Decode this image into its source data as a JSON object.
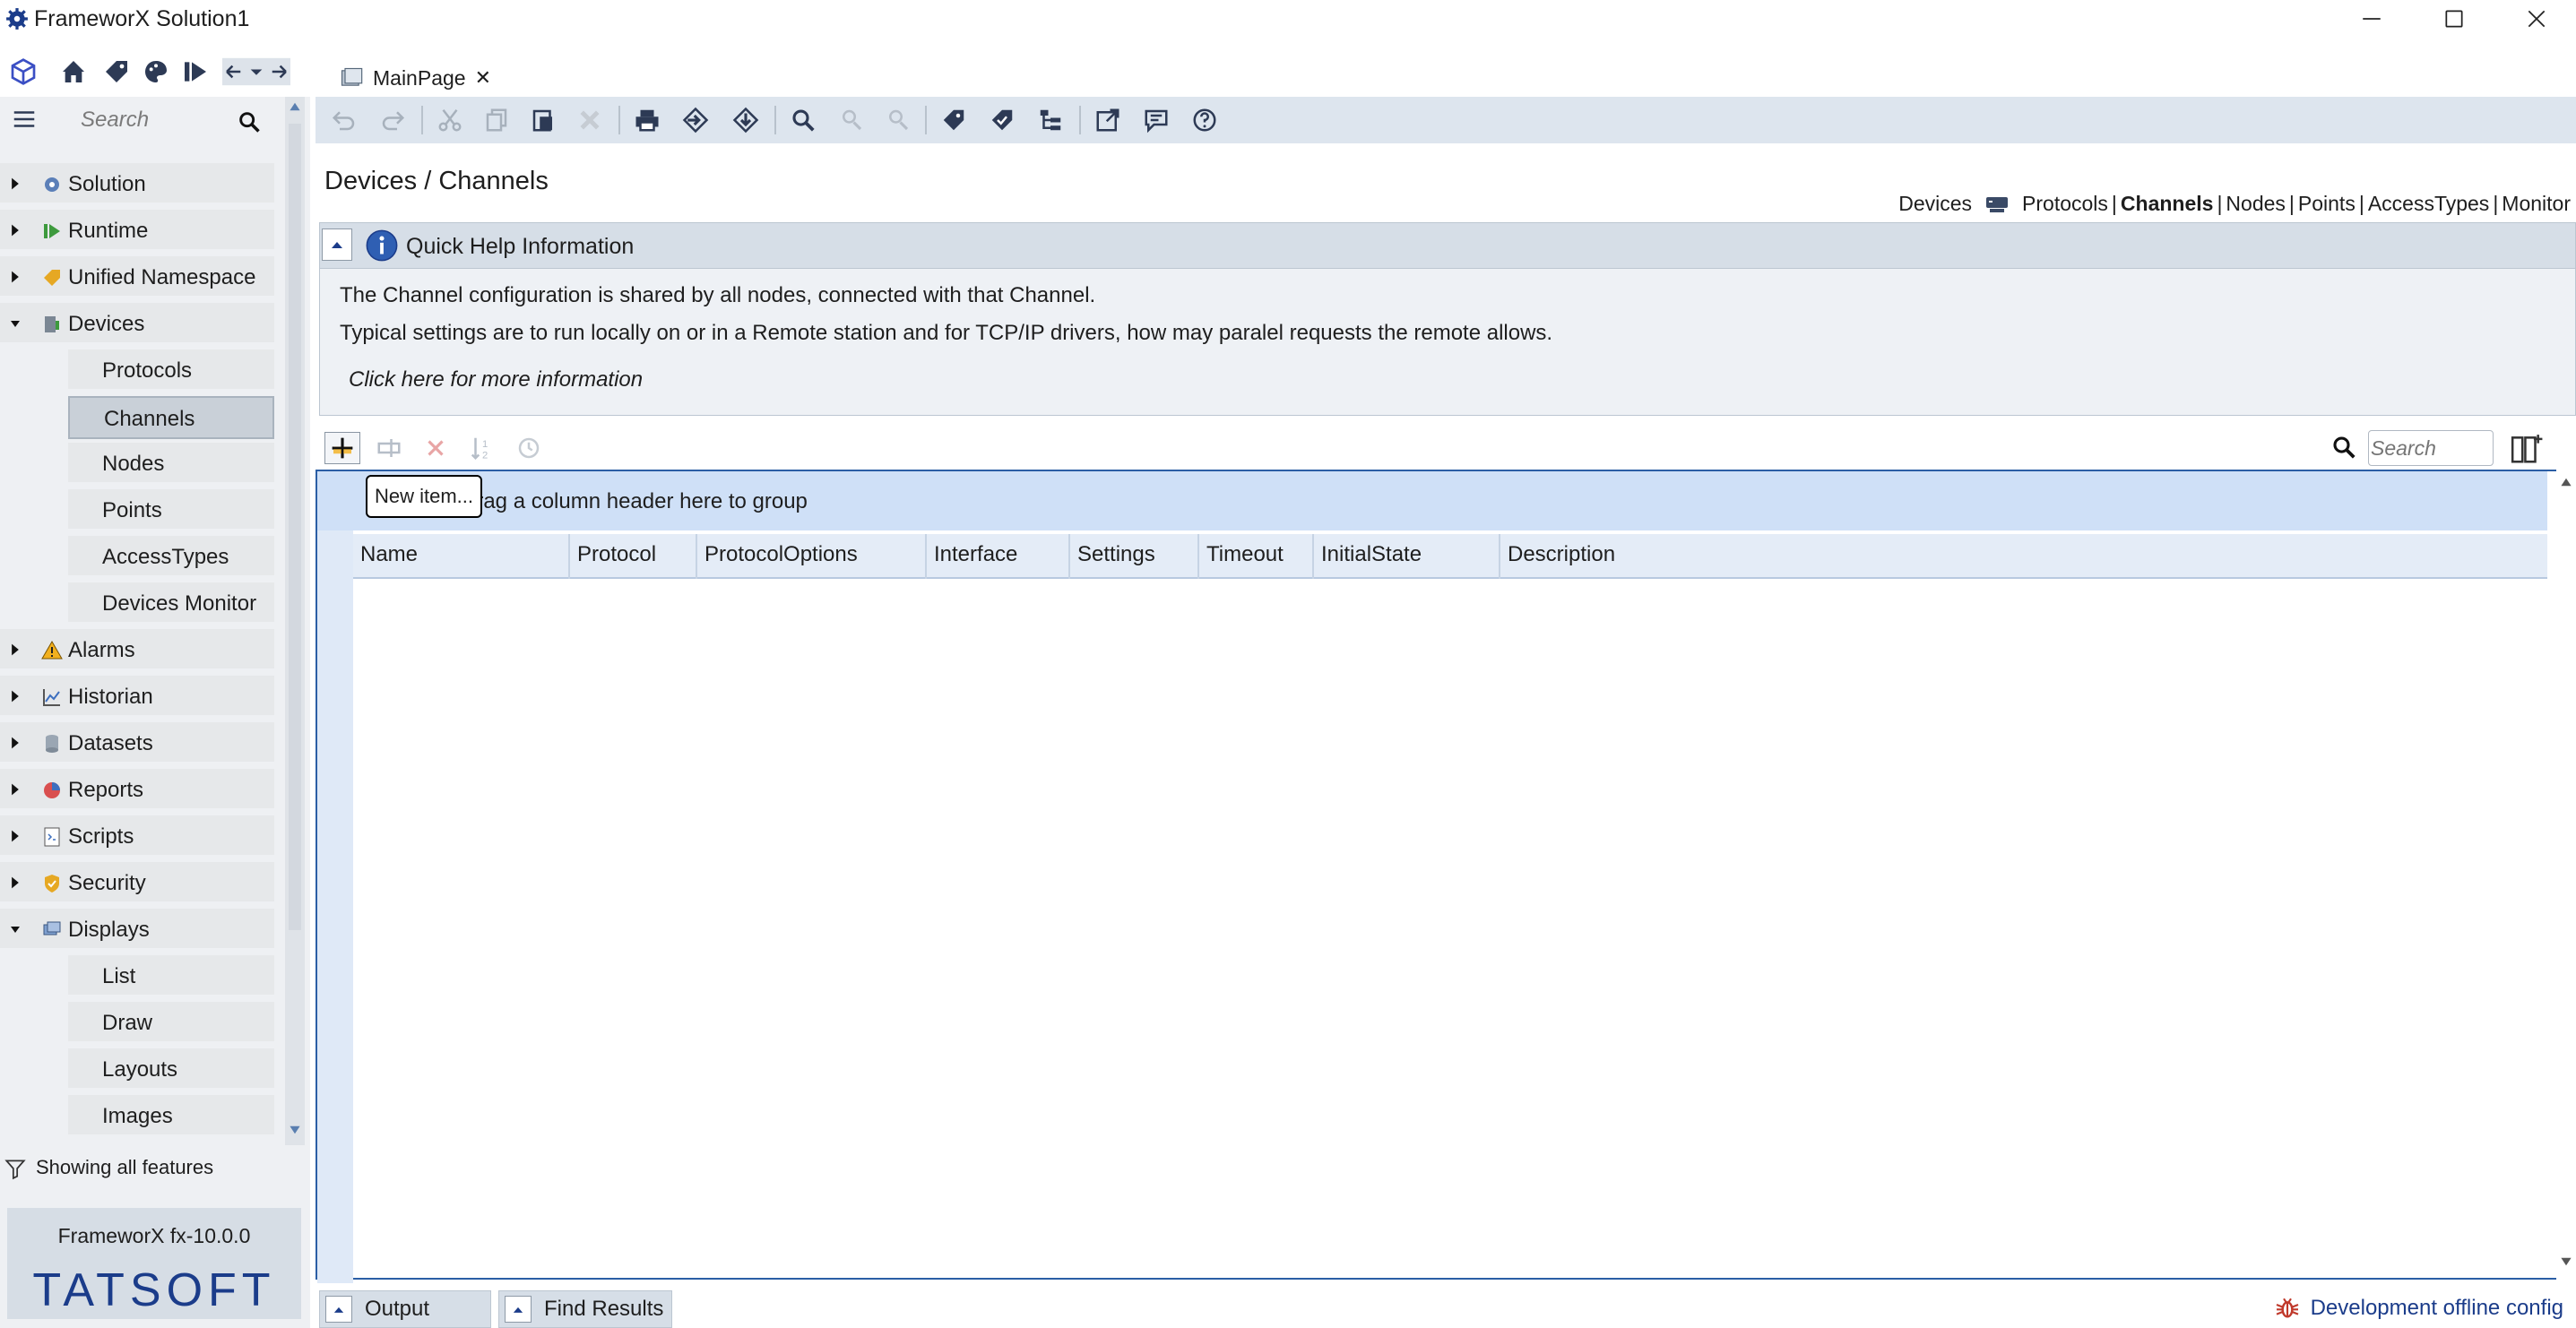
{
  "window": {
    "title": "FrameworX Solution1"
  },
  "doc_tab": {
    "label": "MainPage"
  },
  "nav_search": {
    "placeholder": "Search"
  },
  "tree": {
    "items": [
      {
        "label": "Solution"
      },
      {
        "label": "Runtime"
      },
      {
        "label": "Unified Namespace"
      },
      {
        "label": "Devices"
      },
      {
        "label": "Alarms"
      },
      {
        "label": "Historian"
      },
      {
        "label": "Datasets"
      },
      {
        "label": "Reports"
      },
      {
        "label": "Scripts"
      },
      {
        "label": "Security"
      },
      {
        "label": "Displays"
      }
    ],
    "devices_children": [
      "Protocols",
      "Channels",
      "Nodes",
      "Points",
      "AccessTypes",
      "Devices Monitor"
    ],
    "displays_children": [
      "List",
      "Draw",
      "Layouts",
      "Images"
    ],
    "selected": "Channels"
  },
  "filter": {
    "label": "Showing all features"
  },
  "version": {
    "text": "FrameworX fx-10.0.0",
    "logo": "TATSOFT"
  },
  "page": {
    "title": "Devices / Channels",
    "crumbs": {
      "devices": "Devices",
      "protocols": "Protocols",
      "channels": "Channels",
      "nodes": "Nodes",
      "points": "Points",
      "accesstypes": "AccessTypes",
      "monitor": "Monitor",
      "sep": "|"
    }
  },
  "quick_help": {
    "title": "Quick Help Information",
    "line1": "The Channel configuration is shared by all nodes, connected with that Channel.",
    "line2": "Typical settings are to run locally on or in a Remote station and for TCP/IP drivers, how may paralel requests the remote allows.",
    "link": "Click here for more information"
  },
  "grid": {
    "search_placeholder": "Search",
    "group_panel_text": "Drag a column header here to group",
    "tooltip": "New item...",
    "columns": [
      "Name",
      "Protocol",
      "ProtocolOptions",
      "Interface",
      "Settings",
      "Timeout",
      "InitialState",
      "Description"
    ]
  },
  "bottom": {
    "tabs": [
      "Output",
      "Find Results"
    ],
    "status": "Development offline config"
  },
  "colors": {
    "accent": "#2b5ea5",
    "logo": "#1b3c8a",
    "delete": "#d9534f"
  }
}
